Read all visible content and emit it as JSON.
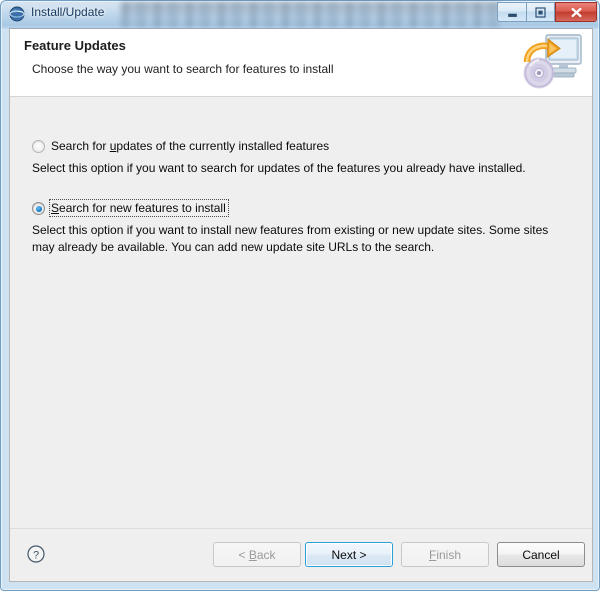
{
  "window": {
    "title": "Install/Update",
    "app_icon": "eclipse-globe-icon",
    "controls": {
      "minimize": "minimize-icon",
      "maximize": "restore-icon",
      "close": "close-icon"
    }
  },
  "header": {
    "title": "Feature Updates",
    "subtitle": "Choose the way you want to search for features to install",
    "icon": "monitor-update-icon"
  },
  "options": [
    {
      "label_pre": "Search for ",
      "label_mnemonic": "u",
      "label_post": "pdates of the currently installed features",
      "description": "Select this option if you want to search for updates of the features you already have installed.",
      "selected": false,
      "focused": false
    },
    {
      "label_pre": "",
      "label_mnemonic": "S",
      "label_post": "earch for new features to install",
      "description": "Select this option if you want to install new features from existing or new update sites. Some sites may already be available. You can add new update site URLs to the search.",
      "selected": true,
      "focused": true
    }
  ],
  "buttons": {
    "help": "?",
    "back": {
      "pre": "< ",
      "mnemonic": "B",
      "post": "ack",
      "enabled": false,
      "default": false
    },
    "next": {
      "pre": "",
      "mnemonic": "N",
      "post": "ext >",
      "enabled": true,
      "default": true
    },
    "finish": {
      "pre": "",
      "mnemonic": "F",
      "post": "inish",
      "enabled": false,
      "default": false
    },
    "cancel": {
      "pre": "",
      "mnemonic": "C",
      "post": "ancel",
      "enabled": true,
      "default": false
    }
  },
  "colors": {
    "accent_default_button_border": "#2c9fd9",
    "radio_selected_fill": "#1a84d0",
    "close_button": "#c23c2e",
    "body_background": "#efefef",
    "header_background": "#ffffff",
    "title_text": "#16385c"
  }
}
